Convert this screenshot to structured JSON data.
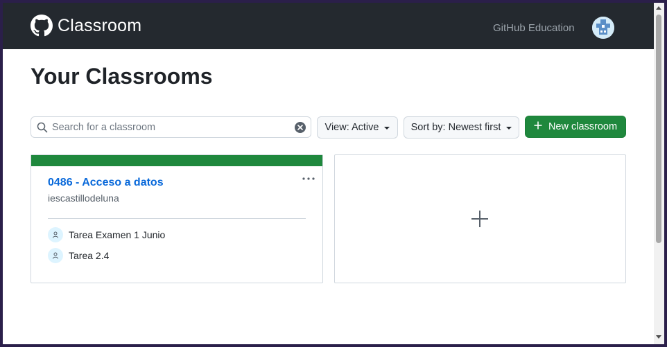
{
  "header": {
    "brand_icon": "github-mark-icon",
    "brand_name": "Classroom",
    "education_link": "GitHub Education",
    "avatar_icon": "user-avatar"
  },
  "page": {
    "title": "Your Classrooms"
  },
  "toolbar": {
    "search_placeholder": "Search for a classroom",
    "search_value": "",
    "view_label": "View: Active",
    "sort_label": "Sort by: Newest first",
    "new_classroom_label": "New classroom"
  },
  "classrooms": [
    {
      "title": "0486 - Acceso a datos",
      "organization": "iescastillodeluna",
      "assignments": [
        {
          "label": "Tarea Examen 1 Junio",
          "icon": "person-icon"
        },
        {
          "label": "Tarea 2.4",
          "icon": "person-icon"
        }
      ]
    }
  ],
  "add_card": {
    "icon": "plus-icon"
  },
  "colors": {
    "header_bg": "#24292f",
    "accent_green": "#1f883d",
    "link_blue": "#0969da"
  }
}
